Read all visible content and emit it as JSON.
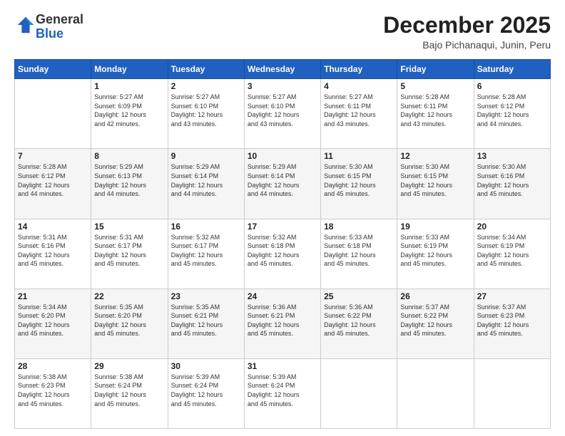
{
  "logo": {
    "general": "General",
    "blue": "Blue"
  },
  "header": {
    "month": "December 2025",
    "location": "Bajo Pichanaqui, Junin, Peru"
  },
  "weekdays": [
    "Sunday",
    "Monday",
    "Tuesday",
    "Wednesday",
    "Thursday",
    "Friday",
    "Saturday"
  ],
  "weeks": [
    [
      {
        "day": "",
        "info": ""
      },
      {
        "day": "1",
        "info": "Sunrise: 5:27 AM\nSunset: 6:09 PM\nDaylight: 12 hours\nand 42 minutes."
      },
      {
        "day": "2",
        "info": "Sunrise: 5:27 AM\nSunset: 6:10 PM\nDaylight: 12 hours\nand 43 minutes."
      },
      {
        "day": "3",
        "info": "Sunrise: 5:27 AM\nSunset: 6:10 PM\nDaylight: 12 hours\nand 43 minutes."
      },
      {
        "day": "4",
        "info": "Sunrise: 5:27 AM\nSunset: 6:11 PM\nDaylight: 12 hours\nand 43 minutes."
      },
      {
        "day": "5",
        "info": "Sunrise: 5:28 AM\nSunset: 6:11 PM\nDaylight: 12 hours\nand 43 minutes."
      },
      {
        "day": "6",
        "info": "Sunrise: 5:28 AM\nSunset: 6:12 PM\nDaylight: 12 hours\nand 44 minutes."
      }
    ],
    [
      {
        "day": "7",
        "info": "Sunrise: 5:28 AM\nSunset: 6:12 PM\nDaylight: 12 hours\nand 44 minutes."
      },
      {
        "day": "8",
        "info": "Sunrise: 5:29 AM\nSunset: 6:13 PM\nDaylight: 12 hours\nand 44 minutes."
      },
      {
        "day": "9",
        "info": "Sunrise: 5:29 AM\nSunset: 6:14 PM\nDaylight: 12 hours\nand 44 minutes."
      },
      {
        "day": "10",
        "info": "Sunrise: 5:29 AM\nSunset: 6:14 PM\nDaylight: 12 hours\nand 44 minutes."
      },
      {
        "day": "11",
        "info": "Sunrise: 5:30 AM\nSunset: 6:15 PM\nDaylight: 12 hours\nand 45 minutes."
      },
      {
        "day": "12",
        "info": "Sunrise: 5:30 AM\nSunset: 6:15 PM\nDaylight: 12 hours\nand 45 minutes."
      },
      {
        "day": "13",
        "info": "Sunrise: 5:30 AM\nSunset: 6:16 PM\nDaylight: 12 hours\nand 45 minutes."
      }
    ],
    [
      {
        "day": "14",
        "info": "Sunrise: 5:31 AM\nSunset: 6:16 PM\nDaylight: 12 hours\nand 45 minutes."
      },
      {
        "day": "15",
        "info": "Sunrise: 5:31 AM\nSunset: 6:17 PM\nDaylight: 12 hours\nand 45 minutes."
      },
      {
        "day": "16",
        "info": "Sunrise: 5:32 AM\nSunset: 6:17 PM\nDaylight: 12 hours\nand 45 minutes."
      },
      {
        "day": "17",
        "info": "Sunrise: 5:32 AM\nSunset: 6:18 PM\nDaylight: 12 hours\nand 45 minutes."
      },
      {
        "day": "18",
        "info": "Sunrise: 5:33 AM\nSunset: 6:18 PM\nDaylight: 12 hours\nand 45 minutes."
      },
      {
        "day": "19",
        "info": "Sunrise: 5:33 AM\nSunset: 6:19 PM\nDaylight: 12 hours\nand 45 minutes."
      },
      {
        "day": "20",
        "info": "Sunrise: 5:34 AM\nSunset: 6:19 PM\nDaylight: 12 hours\nand 45 minutes."
      }
    ],
    [
      {
        "day": "21",
        "info": "Sunrise: 5:34 AM\nSunset: 6:20 PM\nDaylight: 12 hours\nand 45 minutes."
      },
      {
        "day": "22",
        "info": "Sunrise: 5:35 AM\nSunset: 6:20 PM\nDaylight: 12 hours\nand 45 minutes."
      },
      {
        "day": "23",
        "info": "Sunrise: 5:35 AM\nSunset: 6:21 PM\nDaylight: 12 hours\nand 45 minutes."
      },
      {
        "day": "24",
        "info": "Sunrise: 5:36 AM\nSunset: 6:21 PM\nDaylight: 12 hours\nand 45 minutes."
      },
      {
        "day": "25",
        "info": "Sunrise: 5:36 AM\nSunset: 6:22 PM\nDaylight: 12 hours\nand 45 minutes."
      },
      {
        "day": "26",
        "info": "Sunrise: 5:37 AM\nSunset: 6:22 PM\nDaylight: 12 hours\nand 45 minutes."
      },
      {
        "day": "27",
        "info": "Sunrise: 5:37 AM\nSunset: 6:23 PM\nDaylight: 12 hours\nand 45 minutes."
      }
    ],
    [
      {
        "day": "28",
        "info": "Sunrise: 5:38 AM\nSunset: 6:23 PM\nDaylight: 12 hours\nand 45 minutes."
      },
      {
        "day": "29",
        "info": "Sunrise: 5:38 AM\nSunset: 6:24 PM\nDaylight: 12 hours\nand 45 minutes."
      },
      {
        "day": "30",
        "info": "Sunrise: 5:39 AM\nSunset: 6:24 PM\nDaylight: 12 hours\nand 45 minutes."
      },
      {
        "day": "31",
        "info": "Sunrise: 5:39 AM\nSunset: 6:24 PM\nDaylight: 12 hours\nand 45 minutes."
      },
      {
        "day": "",
        "info": ""
      },
      {
        "day": "",
        "info": ""
      },
      {
        "day": "",
        "info": ""
      }
    ]
  ]
}
